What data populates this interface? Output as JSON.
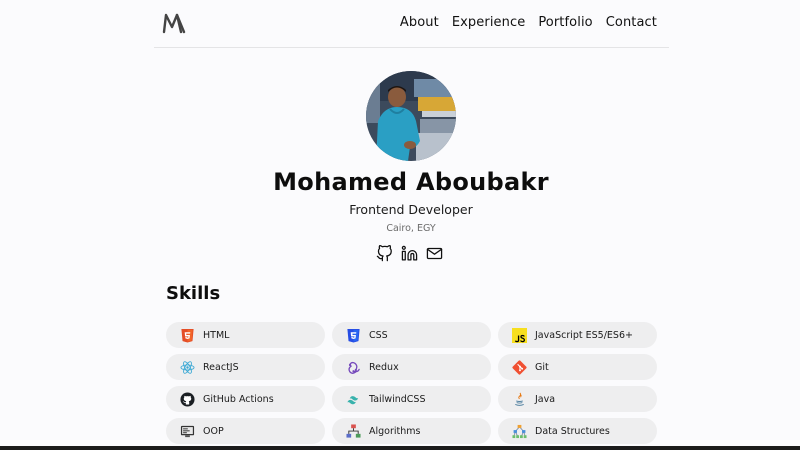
{
  "nav": {
    "links": [
      "About",
      "Experience",
      "Portfolio",
      "Contact"
    ]
  },
  "profile": {
    "name": "Mohamed Aboubakr",
    "role": "Frontend Developer",
    "location": "Cairo, EGY",
    "socials": [
      "github-icon",
      "linkedin-icon",
      "mail-icon"
    ]
  },
  "skills": {
    "title": "Skills",
    "items": [
      {
        "label": "HTML",
        "icon": "html5-icon"
      },
      {
        "label": "CSS",
        "icon": "css3-icon"
      },
      {
        "label": "JavaScript ES5/ES6+",
        "icon": "javascript-icon"
      },
      {
        "label": "ReactJS",
        "icon": "react-icon"
      },
      {
        "label": "Redux",
        "icon": "redux-icon"
      },
      {
        "label": "Git",
        "icon": "git-icon"
      },
      {
        "label": "GitHub Actions",
        "icon": "github-actions-icon"
      },
      {
        "label": "TailwindCSS",
        "icon": "tailwind-icon"
      },
      {
        "label": "Java",
        "icon": "java-icon"
      },
      {
        "label": "OOP",
        "icon": "oop-icon"
      },
      {
        "label": "Algorithms",
        "icon": "algorithms-icon"
      },
      {
        "label": "Data Structures",
        "icon": "data-structures-icon"
      }
    ]
  },
  "colors": {
    "background": "#fbfbfd",
    "chip": "#eeeeef",
    "html": "#e44d26",
    "css": "#264de4",
    "js": "#f7df1e",
    "react": "#61dafb",
    "redux": "#764abc",
    "git": "#f05032",
    "avatar_shirt": "#2a9fc4"
  }
}
